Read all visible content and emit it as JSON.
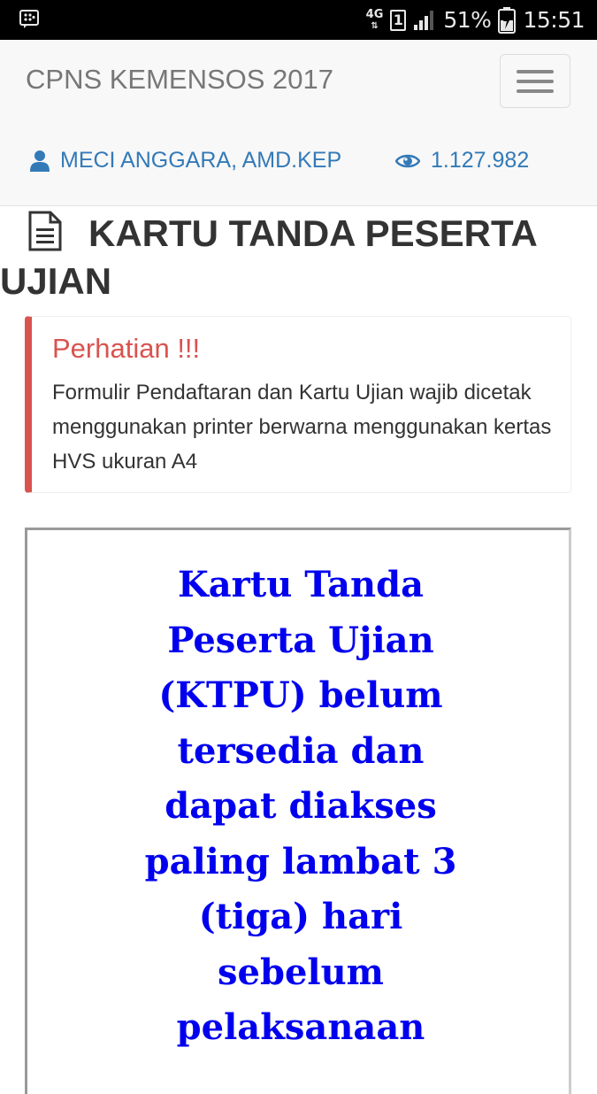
{
  "status_bar": {
    "network": "4G",
    "sim": "1",
    "battery": "51%",
    "time": "15:51",
    "icons": [
      "bbm-notification-icon",
      "network-4g-icon",
      "sim-icon",
      "signal-icon",
      "battery-charging-icon"
    ]
  },
  "navbar": {
    "brand": "CPNS KEMENSOS 2017",
    "user_name": "MECI ANGGARA, AMD.KEP",
    "view_count": "1.127.982",
    "icons": [
      "hamburger-menu-icon",
      "user-icon",
      "eye-icon"
    ]
  },
  "page": {
    "title": "KARTU TANDA PESERTA UJIAN",
    "title_icon": "document-icon"
  },
  "alert": {
    "title": "Perhatian !!!",
    "message": "Formulir Pendaftaran dan Kartu Ujian wajib dicetak menggunakan printer berwarna menggunakan kertas HVS ukuran A4",
    "accent_color": "#d9534f"
  },
  "notice": {
    "text": "Kartu Tanda Peserta Ujian (KTPU) belum tersedia dan dapat diakses paling lambat 3 (tiga) hari sebelum pelaksanaan",
    "text_color": "#0000ee"
  },
  "colors": {
    "link": "#337ab7",
    "navbar_bg": "#f8f8f8",
    "brand_text": "#777777"
  }
}
